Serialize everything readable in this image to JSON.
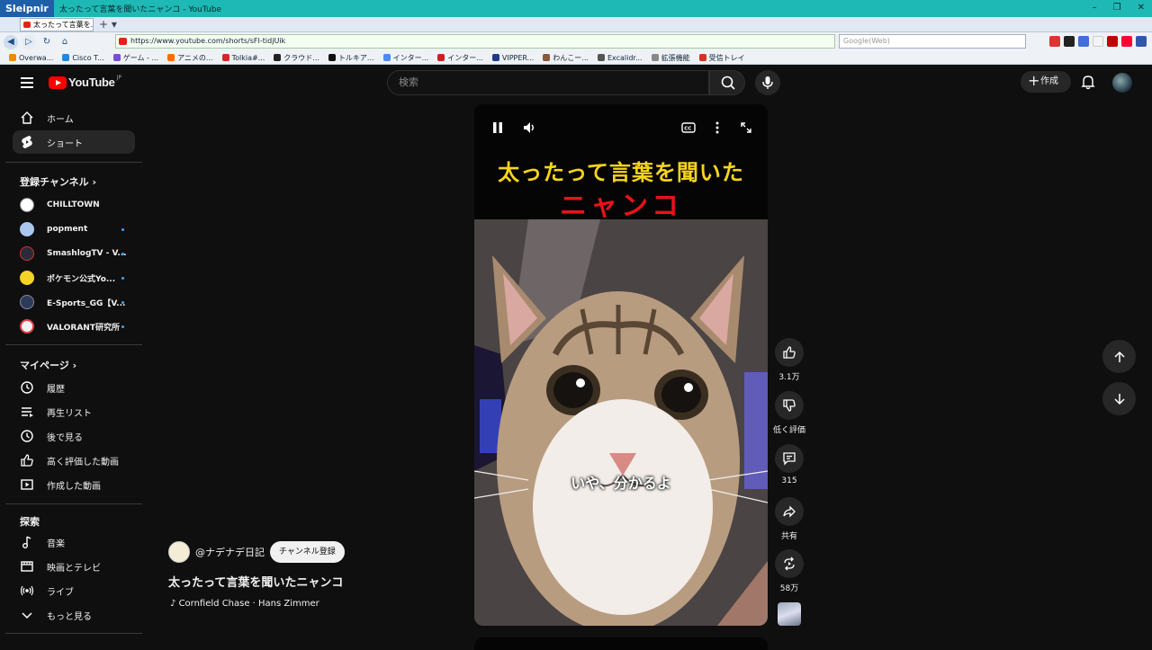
{
  "browser": {
    "app_name": "Sleipnir",
    "window_title": "太ったって言葉を聞いたニャンコ - YouTube",
    "tab_title": "太ったって言葉を...",
    "url": "https://www.youtube.com/shorts/sFI-tidjUik",
    "web_search_placeholder": "Google(Web)",
    "bookmarks": [
      {
        "label": "Overwa...",
        "color": "#f08a00"
      },
      {
        "label": "Cisco T...",
        "color": "#1e88e5"
      },
      {
        "label": "ゲーム - ...",
        "color": "#7b4bd8"
      },
      {
        "label": "アニメの...",
        "color": "#ff6b00"
      },
      {
        "label": "Tolkia#...",
        "color": "#d62828"
      },
      {
        "label": "クラウド...",
        "color": "#222222"
      },
      {
        "label": "トルキア...",
        "color": "#111111"
      },
      {
        "label": "インター...",
        "color": "#4c8bf5"
      },
      {
        "label": "インター...",
        "color": "#c22"
      },
      {
        "label": "VIPPER...",
        "color": "#223a8a"
      },
      {
        "label": "わんこー...",
        "color": "#8a5a3a"
      },
      {
        "label": "Excalidr...",
        "color": "#555555"
      },
      {
        "label": "拡張機能",
        "color": "#888888"
      },
      {
        "label": "受信トレイ",
        "color": "#d93025"
      }
    ]
  },
  "header": {
    "logo_text": "YouTube",
    "logo_region": "JP",
    "search_placeholder": "検索",
    "create_label": "作成"
  },
  "sidebar": {
    "main": [
      {
        "label": "ホーム",
        "icon": "home-icon"
      },
      {
        "label": "ショート",
        "icon": "shorts-icon",
        "active": true
      }
    ],
    "subscriptions_heading": "登録チャンネル",
    "channels": [
      {
        "name": "CHILLTOWN",
        "color": "#ffffff",
        "dot": false
      },
      {
        "name": "popment",
        "color": "#a9c7ef",
        "dot": true
      },
      {
        "name": "SmashlogTV - V...",
        "color": "#2a2a3a",
        "dot": true
      },
      {
        "name": "ポケモン公式Yo...",
        "color": "#f5d327",
        "dot": true
      },
      {
        "name": "E-Sports_GG【V...",
        "color": "#2d3b5a",
        "dot": true
      },
      {
        "name": "VALORANT研究所",
        "color": "#f2f2f2",
        "dot": true
      }
    ],
    "you_heading": "マイページ",
    "you": [
      {
        "label": "履歴",
        "icon": "history-icon"
      },
      {
        "label": "再生リスト",
        "icon": "playlist-icon"
      },
      {
        "label": "後で見る",
        "icon": "watch-later-icon"
      },
      {
        "label": "高く評価した動画",
        "icon": "thumbs-up-icon"
      },
      {
        "label": "作成した動画",
        "icon": "your-videos-icon"
      }
    ],
    "explore_heading": "探索",
    "explore": [
      {
        "label": "音楽",
        "icon": "music-icon"
      },
      {
        "label": "映画とテレビ",
        "icon": "movies-icon"
      },
      {
        "label": "ライブ",
        "icon": "live-icon"
      },
      {
        "label": "もっと見る",
        "icon": "chevron-down-icon"
      }
    ]
  },
  "short": {
    "caption_line1": "太ったって言葉を聞いた",
    "caption_line2": "ニャンコ",
    "subtitle": "いや、分かるよ",
    "channel": "@ナデナデ日記",
    "subscribe_label": "チャンネル登録",
    "title": "太ったって言葉を聞いたニャンコ",
    "music": "Cornfield Chase · Hans Zimmer",
    "likes": "3.1万",
    "dislike_label": "低く評価",
    "comments": "315",
    "share_label": "共有",
    "remix_count": "58万"
  }
}
